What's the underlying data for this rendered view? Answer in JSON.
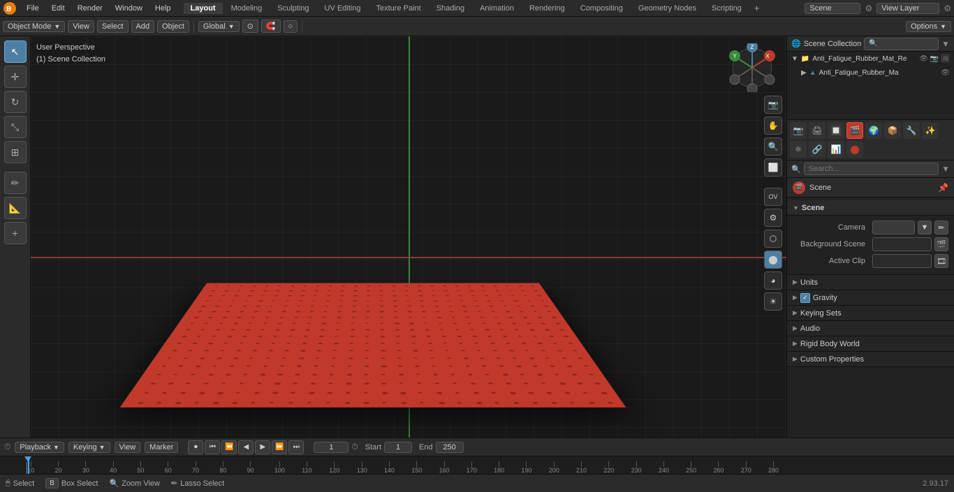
{
  "app": {
    "title": "Blender",
    "version": "2.93.17"
  },
  "top_menu": {
    "items": [
      "File",
      "Edit",
      "Render",
      "Window",
      "Help"
    ],
    "workspaces": [
      "Layout",
      "Modeling",
      "Sculpting",
      "UV Editing",
      "Texture Paint",
      "Shading",
      "Animation",
      "Rendering",
      "Compositing",
      "Geometry Nodes",
      "Scripting"
    ],
    "active_workspace": "Layout",
    "scene_name": "Scene",
    "view_layer": "View Layer"
  },
  "second_toolbar": {
    "mode": "Object Mode",
    "view_label": "View",
    "select_label": "Select",
    "add_label": "Add",
    "object_label": "Object",
    "transform": "Global",
    "options_label": "Options"
  },
  "viewport": {
    "view_label": "User Perspective",
    "collection_label": "(1) Scene Collection"
  },
  "nav_gizmo": {
    "x_label": "X",
    "y_label": "Y",
    "z_label": "Z"
  },
  "outliner": {
    "title": "Scene Collection",
    "items": [
      {
        "name": "Anti_Fatigue_Rubber_Mat_Re",
        "indent": 0,
        "icon": "▶",
        "has_eye": true,
        "has_camera": true,
        "has_render": true
      },
      {
        "name": "Anti_Fatigue_Rubber_Ma",
        "indent": 1,
        "icon": "▲",
        "has_eye": true,
        "has_camera": false,
        "has_render": false
      }
    ]
  },
  "properties": {
    "search_placeholder": "Search...",
    "active_icon": "scene",
    "header_title": "Scene",
    "sections": [
      {
        "title": "Scene",
        "expanded": true,
        "rows": [
          {
            "label": "Camera",
            "value": "",
            "has_icon": true
          },
          {
            "label": "Background Scene",
            "value": "",
            "has_icon": true
          },
          {
            "label": "Active Clip",
            "value": "",
            "has_icon": true
          }
        ]
      },
      {
        "title": "Units",
        "expanded": false
      },
      {
        "title": "Gravity",
        "expanded": false,
        "has_checkbox": true,
        "checkbox_checked": true
      },
      {
        "title": "Keying Sets",
        "expanded": false
      },
      {
        "title": "Audio",
        "expanded": false
      },
      {
        "title": "Rigid Body World",
        "expanded": false
      },
      {
        "title": "Custom Properties",
        "expanded": false
      }
    ]
  },
  "timeline": {
    "playback_label": "Playback",
    "keying_label": "Keying",
    "view_label": "View",
    "marker_label": "Marker",
    "current_frame": "1",
    "start_frame": "1",
    "end_frame": "250",
    "start_label": "Start",
    "end_label": "End",
    "ruler_marks": [
      "10",
      "20",
      "30",
      "40",
      "50",
      "60",
      "70",
      "80",
      "90",
      "100",
      "110",
      "120",
      "130",
      "140",
      "150",
      "160",
      "170",
      "180",
      "190",
      "200",
      "210",
      "220",
      "230",
      "240",
      "250",
      "260",
      "270",
      "280"
    ]
  },
  "status_bar": {
    "select_key": "Select",
    "box_select_key": "Box Select",
    "zoom_view_key": "Zoom View",
    "lasso_select_key": "Lasso Select",
    "version": "2.93.17"
  }
}
